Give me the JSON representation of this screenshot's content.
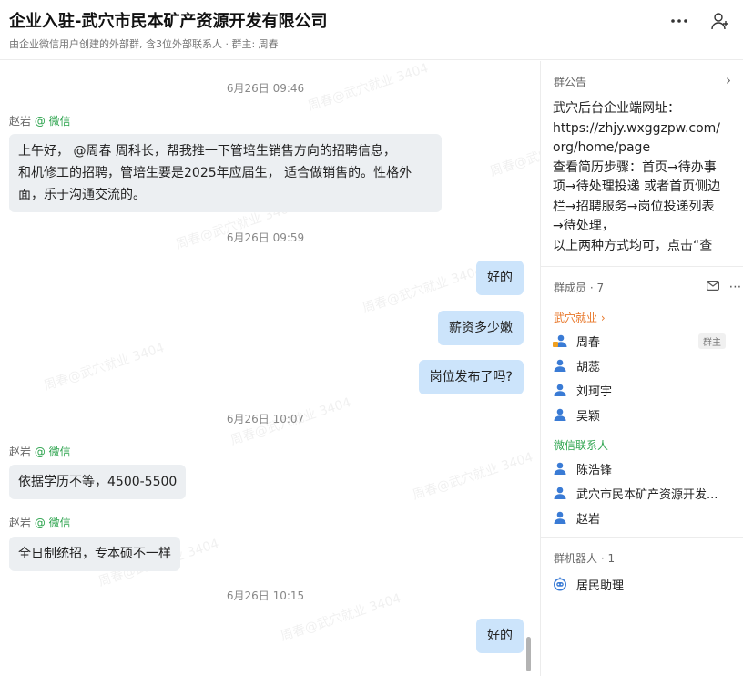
{
  "header": {
    "title": "企业入驻-武穴市民本矿产资源开发有限公司",
    "subtitle": "由企业微信用户创建的外部群, 含3位外部联系人 · 群主: 周春",
    "more_icon": "more-icon",
    "add_member_icon": "add-member-icon"
  },
  "watermark": "周春@武穴就业 3404",
  "messages": [
    {
      "kind": "time",
      "text": "6月26日 09:46"
    },
    {
      "kind": "sender",
      "name": "赵岩",
      "tag": "@ 微信"
    },
    {
      "kind": "in",
      "lines": [
        "上午好， @周春  周科长，帮我推一下管培生销售方向的招聘信息，",
        "和机修工的招聘，管培生要是2025年应届生， 适合做销售的。性格外",
        "面，乐于沟通交流的。"
      ]
    },
    {
      "kind": "time",
      "text": "6月26日 09:59"
    },
    {
      "kind": "out",
      "text": "好的"
    },
    {
      "kind": "out",
      "text": "薪资多少嫩"
    },
    {
      "kind": "out",
      "text": "岗位发布了吗?"
    },
    {
      "kind": "time",
      "text": "6月26日 10:07"
    },
    {
      "kind": "sender",
      "name": "赵岩",
      "tag": "@ 微信"
    },
    {
      "kind": "in",
      "text": "依据学历不等，4500-5500"
    },
    {
      "kind": "sender",
      "name": "赵岩",
      "tag": "@ 微信"
    },
    {
      "kind": "in",
      "text": "全日制统招，专本硕不一样"
    },
    {
      "kind": "time",
      "text": "6月26日 10:15"
    },
    {
      "kind": "out",
      "text": "好的"
    }
  ],
  "sidebar": {
    "announcement_label": "群公告",
    "announcement_lines": [
      "武穴后台企业端网址：",
      "https://zhjy.wxggzpw.com/",
      "org/home/page",
      "查看简历步骤：首页→待办事",
      "项→待处理投递 或者首页侧边",
      "栏→招聘服务→岗位投递列表",
      "→待处理，",
      "以上两种方式均可，点击“查"
    ],
    "members_label": "群成员 · 7",
    "internal_group": "武穴就业 ›",
    "internal_members": [
      {
        "name": "周春",
        "badge": "群主"
      },
      {
        "name": "胡蕊"
      },
      {
        "name": "刘珂宇"
      },
      {
        "name": "吴颖"
      }
    ],
    "external_group": "微信联系人",
    "external_members": [
      {
        "name": "陈浩锋"
      },
      {
        "name": "武穴市民本矿产资源开发..."
      },
      {
        "name": "赵岩"
      }
    ],
    "bots_label": "群机器人 · 1",
    "bot": {
      "name": "居民助理"
    }
  },
  "colors": {
    "bubble_in": "#eceff2",
    "bubble_out": "#cce4fb",
    "wechat_green": "#2ea44f",
    "group_orange": "#e8782b",
    "owner_person_orange": "#f0a020",
    "person_blue": "#3a7bd5"
  }
}
